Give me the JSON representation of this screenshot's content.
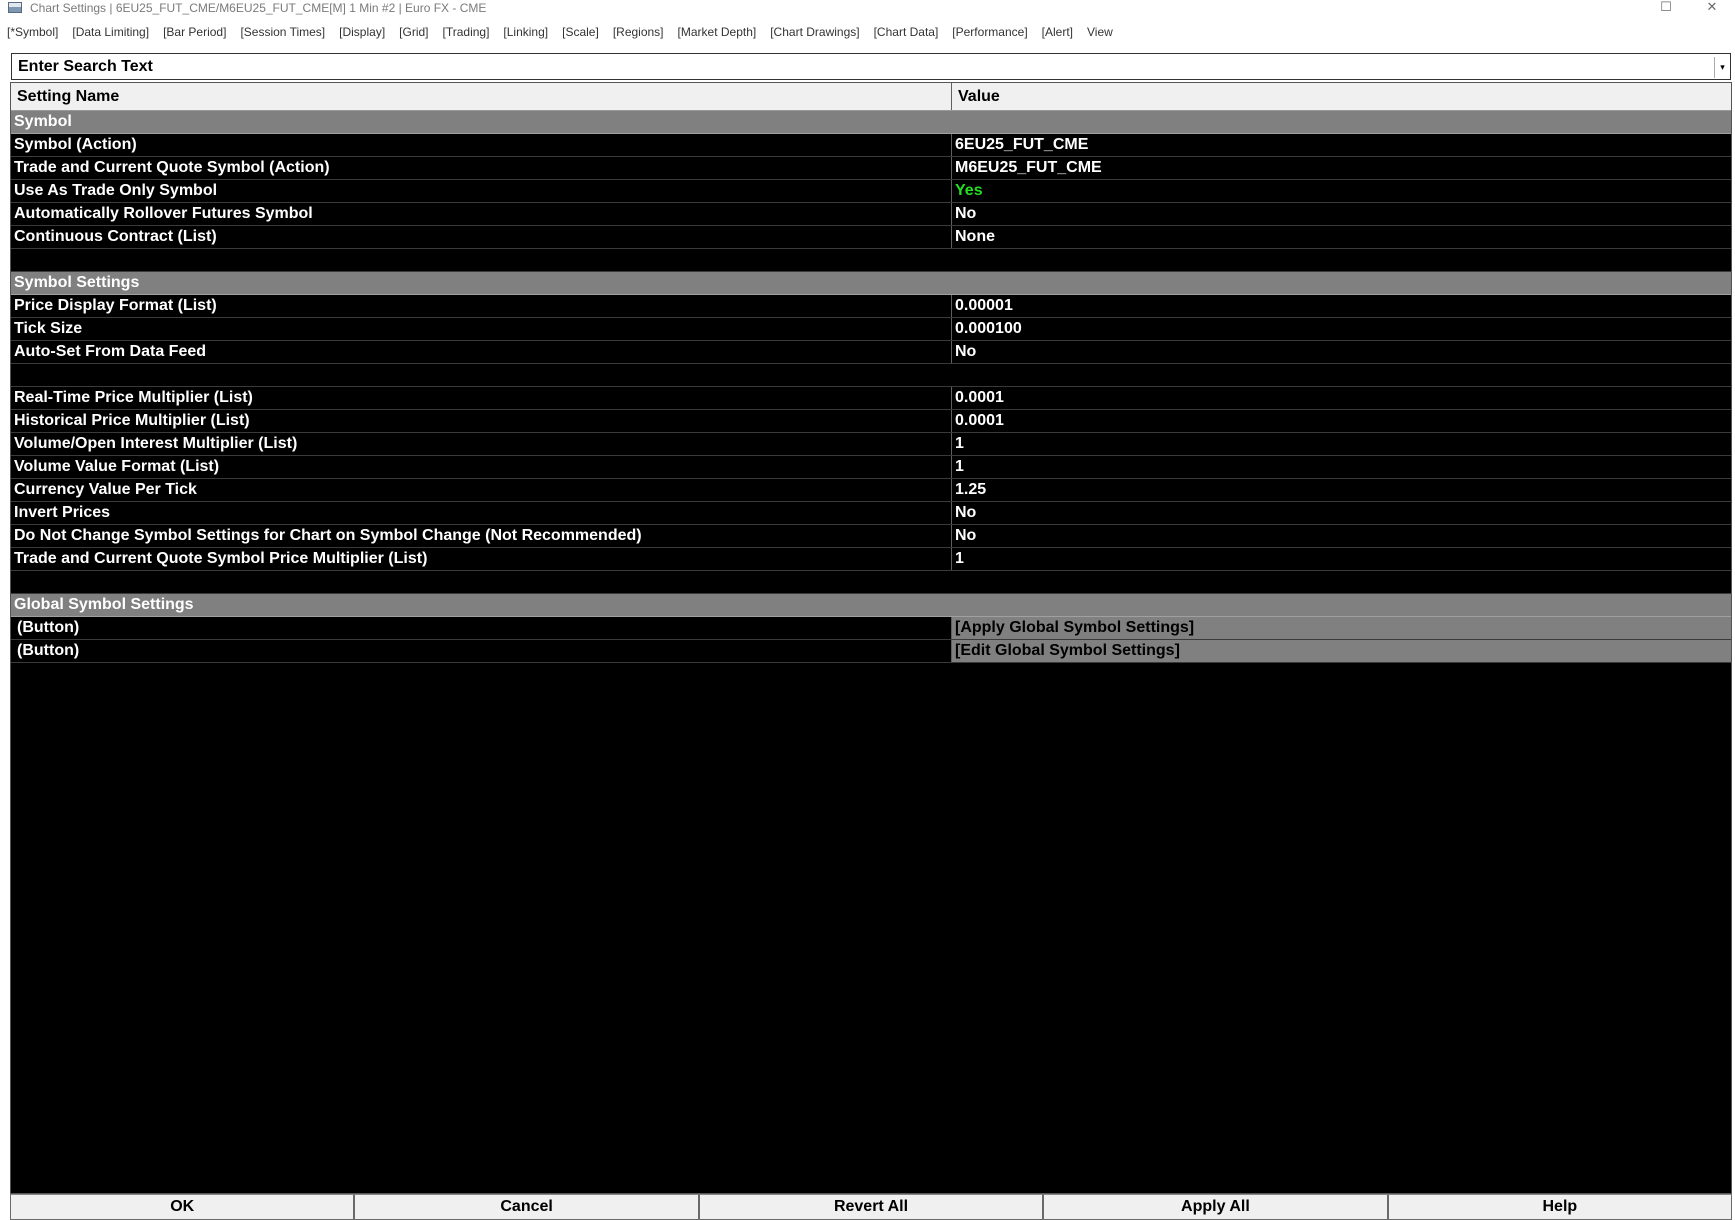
{
  "window": {
    "title": "Chart Settings | 6EU25_FUT_CME/M6EU25_FUT_CME[M]  1 Min  #2 | Euro FX - CME",
    "maximize_glyph": "☐",
    "close_glyph": "✕"
  },
  "tabs": [
    "[*Symbol]",
    "[Data Limiting]",
    "[Bar Period]",
    "[Session Times]",
    "[Display]",
    "[Grid]",
    "[Trading]",
    "[Linking]",
    "[Scale]",
    "[Regions]",
    "[Market Depth]",
    "[Chart Drawings]",
    "[Chart Data]",
    "[Performance]",
    "[Alert]",
    "View"
  ],
  "search": {
    "placeholder": "Enter Search Text",
    "dropdown_glyph": "▾"
  },
  "grid": {
    "header_name": "Setting Name",
    "header_value": "Value",
    "sections": {
      "symbol": {
        "title": "Symbol",
        "rows": [
          {
            "name": "Symbol (Action)",
            "value": "6EU25_FUT_CME"
          },
          {
            "name": "Trade and Current Quote Symbol (Action)",
            "value": "M6EU25_FUT_CME"
          },
          {
            "name": "Use As Trade Only Symbol",
            "value": "Yes"
          },
          {
            "name": "Automatically Rollover Futures Symbol",
            "value": "No"
          },
          {
            "name": "Continuous Contract (List)",
            "value": "None"
          }
        ]
      },
      "symbol_settings": {
        "title": "Symbol Settings",
        "rows_a": [
          {
            "name": "Price Display Format (List)",
            "value": "0.00001"
          },
          {
            "name": "Tick Size",
            "value": "0.000100"
          },
          {
            "name": "Auto-Set From Data Feed",
            "value": "No"
          }
        ],
        "rows_b": [
          {
            "name": "Real-Time Price Multiplier (List)",
            "value": "0.0001"
          },
          {
            "name": "Historical Price Multiplier (List)",
            "value": "0.0001"
          },
          {
            "name": "Volume/Open Interest Multiplier (List)",
            "value": "1"
          },
          {
            "name": "Volume Value Format (List)",
            "value": "1"
          },
          {
            "name": "Currency Value Per Tick",
            "value": "1.25"
          },
          {
            "name": "Invert Prices",
            "value": "No"
          },
          {
            "name": "Do Not Change Symbol Settings for Chart on Symbol Change (Not Recommended)",
            "value": "No"
          },
          {
            "name": "Trade and Current Quote Symbol Price Multiplier (List)",
            "value": "1"
          }
        ]
      },
      "global": {
        "title": "Global Symbol Settings",
        "rows": [
          {
            "name": "(Button)",
            "value": "[Apply Global Symbol Settings]"
          },
          {
            "name": "(Button)",
            "value": "[Edit Global Symbol Settings]"
          }
        ]
      }
    }
  },
  "footer": {
    "ok": "OK",
    "cancel": "Cancel",
    "revert_all": "Revert All",
    "apply_all": "Apply All",
    "help": "Help"
  },
  "colors": {
    "yes_value": "#22dd22",
    "section_bg": "#808080",
    "grid_bg": "#000000"
  }
}
